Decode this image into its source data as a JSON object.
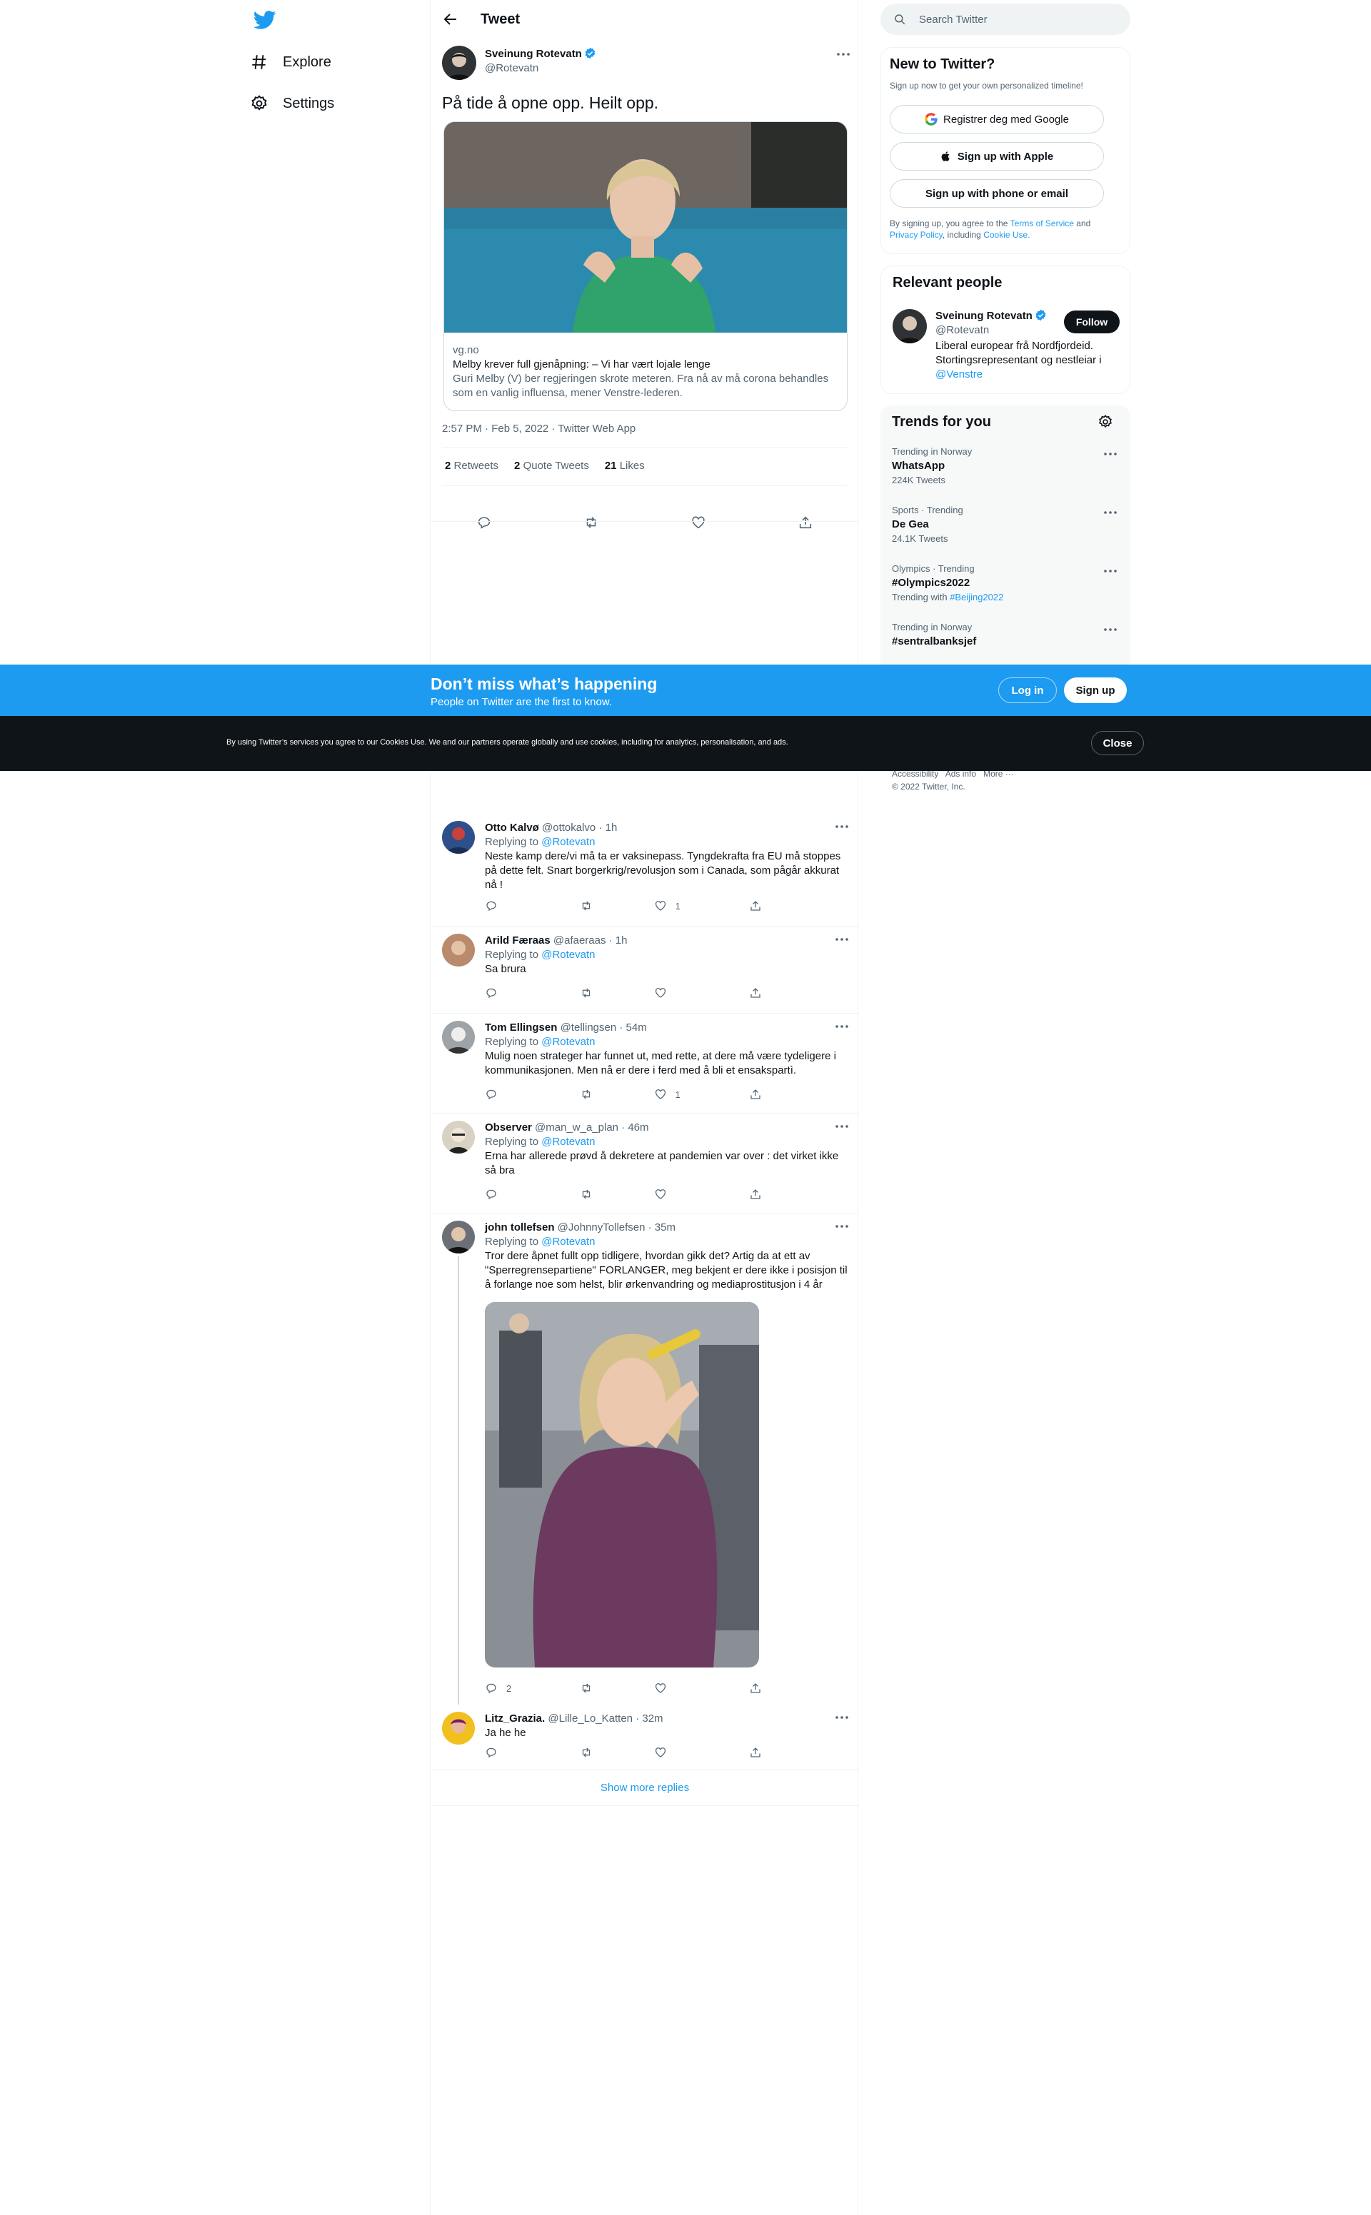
{
  "nav": {
    "explore": "Explore",
    "settings": "Settings"
  },
  "header": {
    "title": "Tweet"
  },
  "main_tweet": {
    "author_name": "Sveinung Rotevatn",
    "author_handle": "@Rotevatn",
    "text": "På tide å opne opp. Heilt opp.",
    "card": {
      "domain": "vg.no",
      "title": "Melby krever full gjenåpning: – Vi har vært lojale lenge",
      "description": "Guri Melby (V) ber regjeringen skrote meteren. Fra nå av må corona behandles som en vanlig influensa, mener Venstre-lederen."
    },
    "timestamp": "2:57 PM · Feb 5, 2022 · Twitter Web App",
    "stats": {
      "retweets_count": "2",
      "retweets_label": "Retweets",
      "quotes_count": "2",
      "quotes_label": "Quote Tweets",
      "likes_count": "21",
      "likes_label": "Likes"
    }
  },
  "replies": [
    {
      "name": "Otto Kalvø",
      "meta": "@ottokalvo · 1h",
      "replying_prefix": "Replying to",
      "replying_to": "@Rotevatn",
      "text": "Neste kamp dere/vi må ta er vaksinepass. Tyngdekrafta fra EU må stoppes på dette felt. Snart borgerkrig/revolusjon som i Canada, som pågår akkurat nå !",
      "replies": "",
      "likes": "1"
    },
    {
      "name": "Arild Færaas",
      "meta": "@afaeraas · 1h",
      "replying_prefix": "Replying to",
      "replying_to": "@Rotevatn",
      "text": "Sa brura",
      "replies": "",
      "likes": ""
    },
    {
      "name": "Tom Ellingsen",
      "meta": "@tellingsen · 54m",
      "replying_prefix": "Replying to",
      "replying_to": "@Rotevatn",
      "text": "Mulig noen strateger har funnet ut, med rette, at dere må være tydeligere i kommunikasjonen. Men nå er dere i ferd med å bli et ensakspartì.",
      "replies": "",
      "likes": "1"
    },
    {
      "name": "Observer",
      "meta": "@man_w_a_plan · 46m",
      "replying_prefix": "Replying to",
      "replying_to": "@Rotevatn",
      "text": "Erna har allerede prøvd å dekretere at pandemien var over : det virket ikke så bra",
      "replies": "",
      "likes": ""
    },
    {
      "name": "john tollefsen",
      "meta": "@JohnnyTollefsen · 35m",
      "replying_prefix": "Replying to",
      "replying_to": "@Rotevatn",
      "text": "Tror dere åpnet fullt opp tidligere, hvordan gikk det? Artig da at ett av \"Sperregrensepartiene\" FORLANGER, meg bekjent er dere ikke i posisjon til å forlange noe som helst, blir ørkenvandring og mediaprostitusjon i 4 år",
      "replies": "2",
      "likes": ""
    },
    {
      "name": "Litz_Grazia.",
      "meta": "@Lille_Lo_Katten · 32m",
      "replying_prefix": "",
      "replying_to": "",
      "text": "Ja he he",
      "replies": "",
      "likes": ""
    }
  ],
  "show_more": "Show more replies",
  "search": {
    "placeholder": "Search Twitter"
  },
  "signup_panel": {
    "title": "New to Twitter?",
    "subtitle": "Sign up now to get your own personalized timeline!",
    "google": "Registrer deg med Google",
    "apple": "Sign up with Apple",
    "phone": "Sign up with phone or email",
    "legal_prefix": "By signing up, you agree to the",
    "tos": "Terms of Service",
    "and": "and",
    "privacy": "Privacy Policy",
    "including": ", including",
    "cookie": "Cookie Use."
  },
  "relevant": {
    "title": "Relevant people",
    "name": "Sveinung Rotevatn",
    "handle": "@Rotevatn",
    "follow": "Follow",
    "bio": "Liberal europear frå Nordfjordeid. Stortingsrepresentant og nestleiar i",
    "bio_link": "@Venstre"
  },
  "trends": {
    "title": "Trends for you",
    "items": [
      {
        "context": "Trending in Norway",
        "name": "WhatsApp",
        "count": "224K Tweets"
      },
      {
        "context": "Sports · Trending",
        "name": "De Gea",
        "count": "24.1K Tweets"
      },
      {
        "context": "Olympics · Trending",
        "name": "#Olympics2022",
        "count": "Trending with",
        "with_tag": "#Beijing2022"
      },
      {
        "context": "Trending in Norway",
        "name": "#sentralbanksjef",
        "count": ""
      }
    ]
  },
  "footer": {
    "accessibility": "Accessibility",
    "ads": "Ads info",
    "more": "More ···",
    "copyright": "© 2022 Twitter, Inc."
  },
  "bluebar": {
    "title": "Don’t miss what’s happening",
    "subtitle": "People on Twitter are the first to know.",
    "login": "Log in",
    "signup": "Sign up"
  },
  "cookiebar": {
    "text": "By using Twitter’s services you agree to our Cookies Use. We and our partners operate globally and use cookies, including for analytics, personalisation, and ads.",
    "close": "Close"
  },
  "colors": {
    "accent": "#1d9bf0",
    "dark": "#0f1419",
    "muted": "#536471"
  }
}
